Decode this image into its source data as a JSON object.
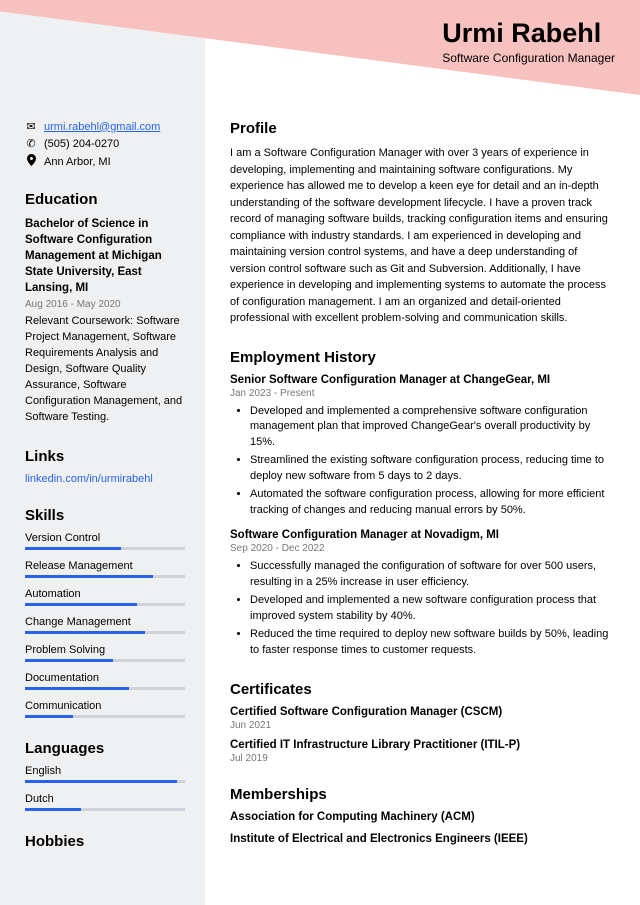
{
  "header": {
    "name": "Urmi Rabehl",
    "title": "Software Configuration Manager"
  },
  "contact": {
    "email": "urmi.rabehl@gmail.com",
    "phone": "(505) 204-0270",
    "location": "Ann Arbor, MI"
  },
  "education": {
    "heading": "Education",
    "degree": "Bachelor of Science in Software Configuration Management at Michigan State University, East Lansing, MI",
    "date": "Aug 2016 - May 2020",
    "description": "Relevant Coursework: Software Project Management, Software Requirements Analysis and Design, Software Quality Assurance, Software Configuration Management, and Software Testing."
  },
  "links": {
    "heading": "Links",
    "url": "linkedin.com/in/urmirabehl"
  },
  "skills": {
    "heading": "Skills",
    "items": [
      {
        "name": "Version Control",
        "level": 60
      },
      {
        "name": "Release Management",
        "level": 80
      },
      {
        "name": "Automation",
        "level": 70
      },
      {
        "name": "Change Management",
        "level": 75
      },
      {
        "name": "Problem Solving",
        "level": 55
      },
      {
        "name": "Documentation",
        "level": 65
      },
      {
        "name": "Communication",
        "level": 30
      }
    ]
  },
  "languages": {
    "heading": "Languages",
    "items": [
      {
        "name": "English",
        "level": 95
      },
      {
        "name": "Dutch",
        "level": 35
      }
    ]
  },
  "hobbies": {
    "heading": "Hobbies"
  },
  "profile": {
    "heading": "Profile",
    "text": "I am a Software Configuration Manager with over 3 years of experience in developing, implementing and maintaining software configurations. My experience has allowed me to develop a keen eye for detail and an in-depth understanding of the software development lifecycle. I have a proven track record of managing software builds, tracking configuration items and ensuring compliance with industry standards. I am experienced in developing and maintaining version control systems, and have a deep understanding of version control software such as Git and Subversion. Additionally, I have experience in developing and implementing systems to automate the process of configuration management. I am an organized and detail-oriented professional with excellent problem-solving and communication skills."
  },
  "employment": {
    "heading": "Employment History",
    "jobs": [
      {
        "title": "Senior Software Configuration Manager at ChangeGear, MI",
        "date": "Jan 2023 - Present",
        "bullets": [
          "Developed and implemented a comprehensive software configuration management plan that improved ChangeGear's overall productivity by 15%.",
          "Streamlined the existing software configuration process, reducing time to deploy new software from 5 days to 2 days.",
          "Automated the software configuration process, allowing for more efficient tracking of changes and reducing manual errors by 50%."
        ]
      },
      {
        "title": "Software Configuration Manager at Novadigm, MI",
        "date": "Sep 2020 - Dec 2022",
        "bullets": [
          "Successfully managed the configuration of software for over 500 users, resulting in a 25% increase in user efficiency.",
          "Developed and implemented a new software configuration process that improved system stability by 40%.",
          "Reduced the time required to deploy new software builds by 50%, leading to faster response times to customer requests."
        ]
      }
    ]
  },
  "certificates": {
    "heading": "Certificates",
    "items": [
      {
        "title": "Certified Software Configuration Manager (CSCM)",
        "date": "Jun 2021"
      },
      {
        "title": "Certified IT Infrastructure Library Practitioner (ITIL-P)",
        "date": "Jul 2019"
      }
    ]
  },
  "memberships": {
    "heading": "Memberships",
    "items": [
      "Association for Computing Machinery (ACM)",
      "Institute of Electrical and Electronics Engineers (IEEE)"
    ]
  }
}
